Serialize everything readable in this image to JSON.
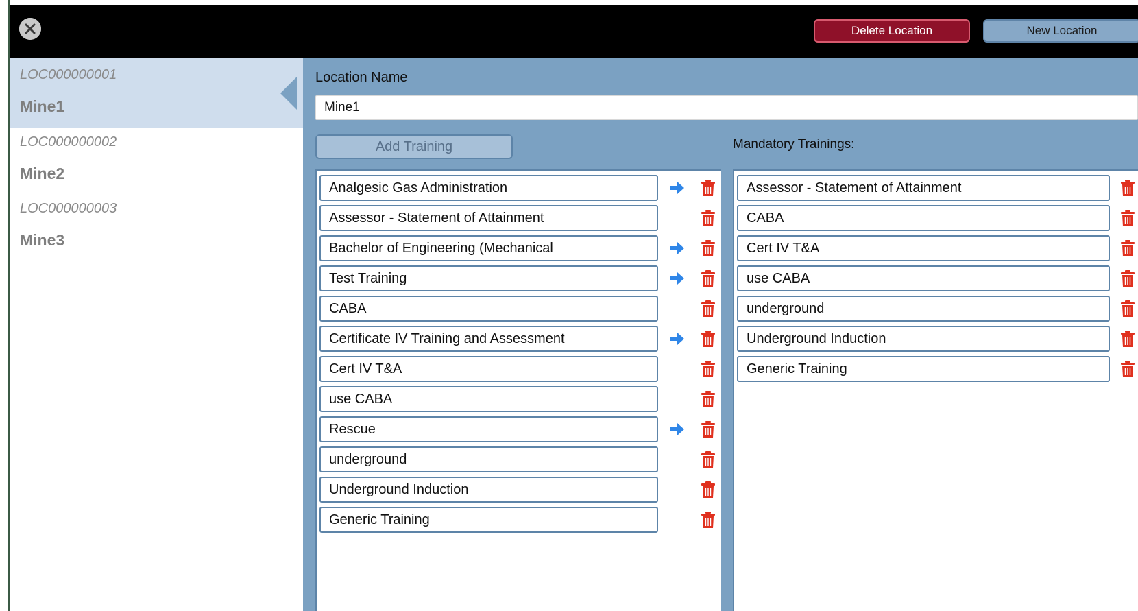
{
  "header": {
    "delete_label": "Delete Location",
    "new_label": "New Location"
  },
  "sidebar": {
    "items": [
      {
        "code": "LOC000000001",
        "name": "Mine1",
        "selected": true
      },
      {
        "code": "LOC000000002",
        "name": "Mine2",
        "selected": false
      },
      {
        "code": "LOC000000003",
        "name": "Mine3",
        "selected": false
      }
    ]
  },
  "form": {
    "location_name_label": "Location Name",
    "location_name_value": "Mine1",
    "add_training_label": "Add Training",
    "mandatory_label": "Mandatory Trainings:"
  },
  "trainings": [
    {
      "name": "Analgesic Gas Administration",
      "can_add": true
    },
    {
      "name": "Assessor - Statement of Attainment",
      "can_add": false
    },
    {
      "name": "Bachelor of Engineering  (Mechanical",
      "can_add": true
    },
    {
      "name": "Test Training",
      "can_add": true
    },
    {
      "name": "CABA",
      "can_add": false
    },
    {
      "name": "Certificate IV Training and Assessment",
      "can_add": true
    },
    {
      "name": "Cert IV T&A",
      "can_add": false
    },
    {
      "name": "use CABA",
      "can_add": false
    },
    {
      "name": "Rescue",
      "can_add": true
    },
    {
      "name": "underground",
      "can_add": false
    },
    {
      "name": "Underground Induction",
      "can_add": false
    },
    {
      "name": "Generic Training",
      "can_add": false
    }
  ],
  "mandatory_trainings": [
    "Assessor - Statement of Attainment",
    "CABA",
    "Cert IV T&A",
    "use CABA",
    "underground",
    "Underground Induction",
    "Generic Training"
  ],
  "colors": {
    "delete_button": "#8f1129",
    "panel_blue": "#7ba1c2",
    "arrow_blue": "#2f86e8",
    "trash_red": "#e0301e"
  },
  "icons": {
    "close": "close-circle-icon",
    "add": "arrow-right-icon",
    "remove": "trash-icon"
  }
}
